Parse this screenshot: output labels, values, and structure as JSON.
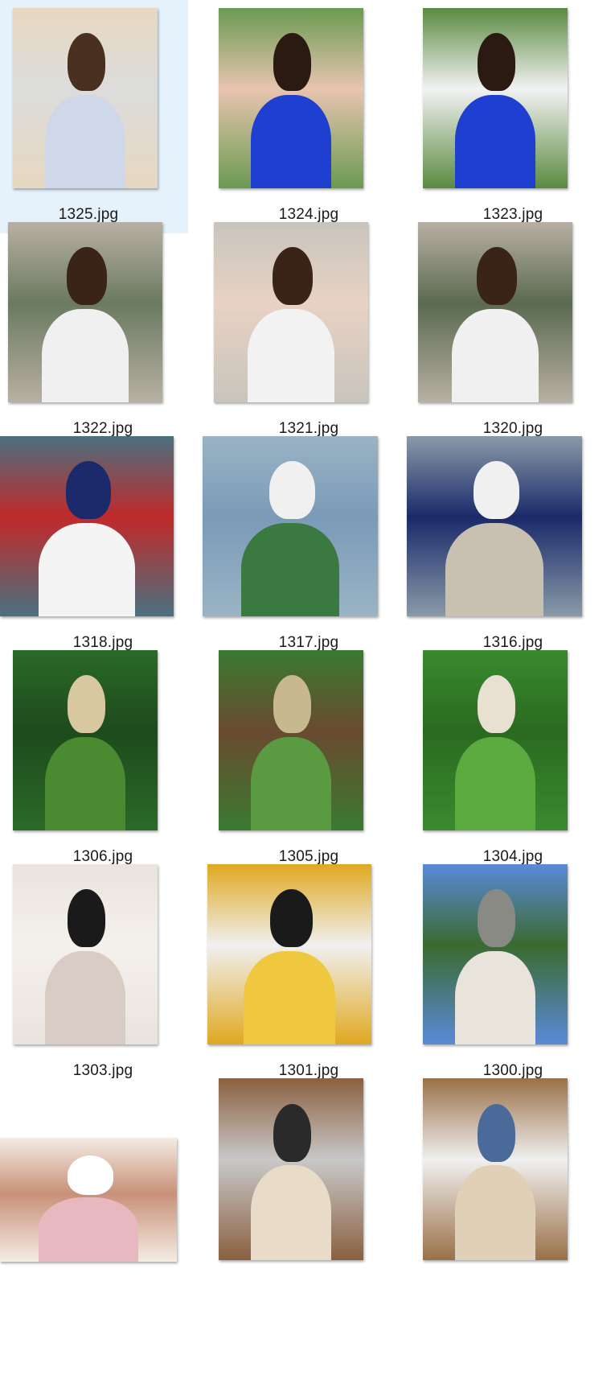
{
  "files": [
    {
      "name": "1325.jpg",
      "selected": true,
      "palette": [
        "#e8d8c0",
        "#cfd8e8",
        "#4a3020",
        "#dcdcdc"
      ]
    },
    {
      "name": "1324.jpg",
      "selected": false,
      "palette": [
        "#6a9a50",
        "#1f3fd0",
        "#2a1a12",
        "#e8c4b0"
      ]
    },
    {
      "name": "1323.jpg",
      "selected": false,
      "palette": [
        "#5a8a40",
        "#1f3fd0",
        "#2a1a12",
        "#f2f2f2"
      ]
    },
    {
      "name": "1322.jpg",
      "selected": false,
      "palette": [
        "#b8b0a4",
        "#f0f0f0",
        "#3a2418",
        "#6a7a60"
      ]
    },
    {
      "name": "1321.jpg",
      "selected": false,
      "palette": [
        "#c8c4bc",
        "#f2f2f2",
        "#3a2418",
        "#e8d2c4"
      ]
    },
    {
      "name": "1320.jpg",
      "selected": false,
      "palette": [
        "#b8b0a4",
        "#f0f0f0",
        "#3a2418",
        "#5a6a50"
      ]
    },
    {
      "name": "1318.jpg",
      "selected": false,
      "palette": [
        "#4a7080",
        "#f4f4f4",
        "#1a2a6a",
        "#c02a2a"
      ]
    },
    {
      "name": "1317.jpg",
      "selected": false,
      "palette": [
        "#9ab4c4",
        "#3a7a40",
        "#f0f0f0",
        "#7a9ab8"
      ]
    },
    {
      "name": "1316.jpg",
      "selected": false,
      "palette": [
        "#8a9aa8",
        "#c8c0b0",
        "#f0f0f0",
        "#1a2a6a"
      ]
    },
    {
      "name": "1306.jpg",
      "selected": false,
      "palette": [
        "#2a6a28",
        "#4a8a30",
        "#d8c8a0",
        "#1e4a1c"
      ]
    },
    {
      "name": "1305.jpg",
      "selected": false,
      "palette": [
        "#3a7a30",
        "#5a9a40",
        "#c8b890",
        "#6a4a30"
      ]
    },
    {
      "name": "1304.jpg",
      "selected": false,
      "palette": [
        "#3a8a30",
        "#5aaa40",
        "#e8e0d0",
        "#2a6a20"
      ]
    },
    {
      "name": "1303.jpg",
      "selected": false,
      "palette": [
        "#eae4de",
        "#d8ccc4",
        "#1a1a1a",
        "#f4f0ec"
      ]
    },
    {
      "name": "1301.jpg",
      "selected": false,
      "palette": [
        "#e0a820",
        "#f0c840",
        "#1a1a1a",
        "#f0f0f0"
      ]
    },
    {
      "name": "1300.jpg",
      "selected": false,
      "palette": [
        "#5a8ad8",
        "#e8e4dc",
        "#8a8a84",
        "#3a6a30"
      ]
    },
    {
      "name": "",
      "selected": false,
      "palette": [
        "#f4ece4",
        "#e8b8c0",
        "#ffffff",
        "#c89078"
      ]
    },
    {
      "name": "",
      "selected": false,
      "palette": [
        "#8a6040",
        "#e8dcc8",
        "#2a2a2a",
        "#c8c8c8"
      ]
    },
    {
      "name": "",
      "selected": false,
      "palette": [
        "#9a7048",
        "#e0d0b8",
        "#4a6a9a",
        "#f0f0f0"
      ]
    }
  ]
}
